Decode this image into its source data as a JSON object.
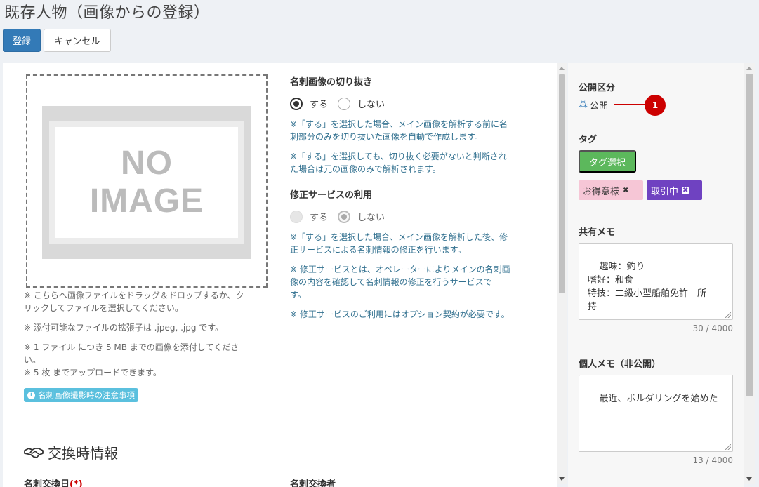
{
  "page": {
    "title": "既存人物（画像からの登録）"
  },
  "toolbar": {
    "register_label": "登録",
    "cancel_label": "キャンセル"
  },
  "upload": {
    "no_image_line1": "NO",
    "no_image_line2": "IMAGE",
    "notes": [
      "※ こちらへ画像ファイルをドラッグ＆ドロップするか、ク\nリックしてファイルを選択してください。",
      "※ 添付可能なファイルの拡張子は .jpeg, .jpg です。",
      "※ 1 ファイル につき 5 MB までの画像を添付してくださ\nい。",
      "※ 5 枚 までアップロードできます。"
    ],
    "info_badge": "名刺画像撮影時の注意事項",
    "info_icon": "info-circle-icon"
  },
  "crop": {
    "label": "名刺画像の切り抜き",
    "option_yes": "する",
    "option_no": "しない",
    "selected": "yes",
    "notes": [
      "※「する」を選択した場合、メイン画像を解析する前に名\n刺部分のみを切り抜いた画像を自動で作成します。",
      "※「する」を選択しても、切り抜く必要がないと判断され\nた場合は元の画像のみで解析されます。"
    ]
  },
  "correction": {
    "label": "修正サービスの利用",
    "option_yes": "する",
    "option_no": "しない",
    "selected": "no",
    "notes": [
      "※「する」を選択した場合、メイン画像を解析した後、修\n正サービスによる名刺情報の修正を行います。",
      "※ 修正サービスとは、オペレーターによりメインの名刺画\n像の内容を確認して名刺情報の修正を行うサービスで\nす。",
      "※ 修正サービスのご利用にはオプション契約が必要です。"
    ]
  },
  "exchange": {
    "section_title": "交換時情報",
    "section_icon": "handshake-icon",
    "date_label": "名刺交換日",
    "required_mark": "(*)",
    "person_label": "名刺交換者"
  },
  "side": {
    "public_label": "公開区分",
    "public_value": "公開",
    "public_icon": "sitemap-icon",
    "callout_number": "1",
    "tags_label": "タグ",
    "tag_select_label": "タグ選択",
    "tags": [
      {
        "label": "お得意様",
        "color": "#f6c6d6"
      },
      {
        "label": "取引中",
        "color": "#6f42c1"
      }
    ],
    "shared_memo_label": "共有メモ",
    "shared_memo_value": "趣味：釣り\n嗜好：和食\n特技：二級小型船舶免許　所\n持",
    "shared_memo_count": "30 / 4000",
    "private_memo_label": "個人メモ（非公開）",
    "private_memo_value": "最近、ボルダリングを始めた",
    "private_memo_count": "13 / 4000"
  },
  "colors": {
    "primary": "#337ab7",
    "success": "#5cb85c",
    "info": "#5bc0de",
    "callout": "#cc0000"
  }
}
